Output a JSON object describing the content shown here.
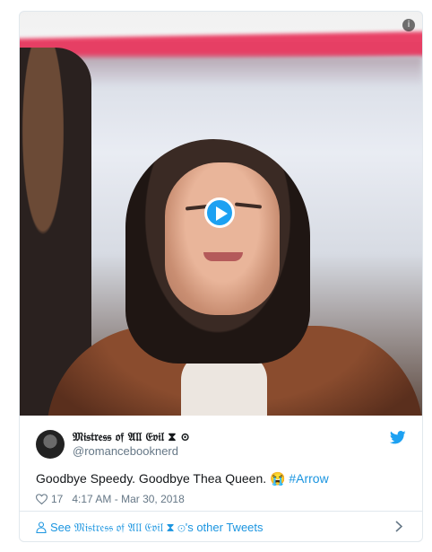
{
  "media": {
    "info_icon": "info-icon",
    "play_icon": "play-icon"
  },
  "tweet": {
    "author_name": "𝔐𝔦𝔰𝔱𝔯𝔢𝔰𝔰 𝔬𝔣 𝔄𝔩𝔩 𝔈𝔳𝔦𝔩 ⧗ ⊙",
    "handle": "@romancebooknerd",
    "text_main": "Goodbye Speedy. Goodbye Thea Queen. 😭 ",
    "hashtag": "#Arrow",
    "likes": "17",
    "timestamp": "4:17 AM - Mar 30, 2018",
    "brand_icon": "twitter-bird-icon"
  },
  "footer": {
    "see_other": "See 𝔐𝔦𝔰𝔱𝔯𝔢𝔰𝔰 𝔬𝔣 𝔄𝔩𝔩 𝔈𝔳𝔦𝔩 ⧗ ⊙'s other Tweets"
  },
  "colors": {
    "accent": "#1da1f2",
    "link": "#1b95e0",
    "muted": "#657786",
    "border": "#e1e8ed"
  }
}
